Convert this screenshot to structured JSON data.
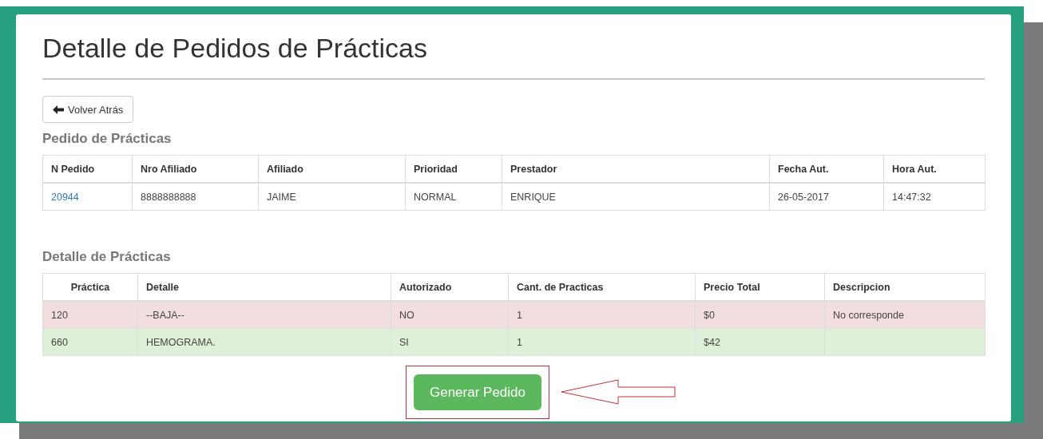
{
  "title": "Detalle de Pedidos de Prácticas",
  "back_button": {
    "label": "Volver Atrás"
  },
  "order": {
    "heading": "Pedido de Prácticas",
    "columns": [
      "N Pedido",
      "Nro Afiliado",
      "Afiliado",
      "Prioridad",
      "Prestador",
      "Fecha Aut.",
      "Hora Aut."
    ],
    "rows": [
      {
        "cells": [
          "20944",
          "8888888888",
          "JAIME",
          "NORMAL",
          "ENRIQUE",
          "26-05-2017",
          "14:47:32"
        ]
      }
    ]
  },
  "details": {
    "heading": "Detalle de Prácticas",
    "columns": [
      "Práctica",
      "Detalle",
      "Autorizado",
      "Cant. de Practicas",
      "Precio Total",
      "Descripcion"
    ],
    "rows": [
      {
        "kind": "danger",
        "cells": [
          "120",
          "--BAJA--",
          "NO",
          "1",
          "$0",
          "No corresponde"
        ]
      },
      {
        "kind": "success",
        "cells": [
          "660",
          "HEMOGRAMA.",
          "SI",
          "1",
          "$42",
          ""
        ]
      }
    ]
  },
  "submit_button": {
    "label": "Generar Pedido"
  }
}
